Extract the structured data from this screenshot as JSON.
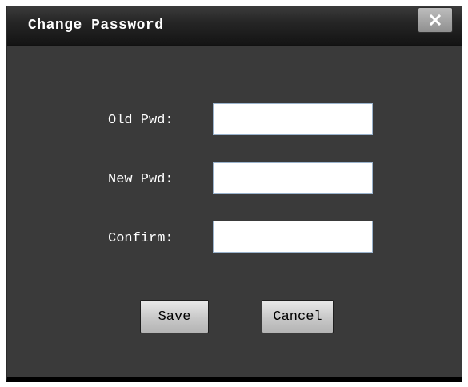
{
  "dialog": {
    "title": "Change Password",
    "close_icon": "close-icon"
  },
  "form": {
    "old_pwd": {
      "label": "Old Pwd:",
      "value": ""
    },
    "new_pwd": {
      "label": "New Pwd:",
      "value": ""
    },
    "confirm": {
      "label": "Confirm:",
      "value": ""
    }
  },
  "buttons": {
    "save_label": "Save",
    "cancel_label": "Cancel"
  },
  "colors": {
    "dialog_bg": "#3a3a3a",
    "titlebar_bg": "#1c1c1c",
    "text": "#ffffff",
    "field_border": "#9bb3cc"
  }
}
